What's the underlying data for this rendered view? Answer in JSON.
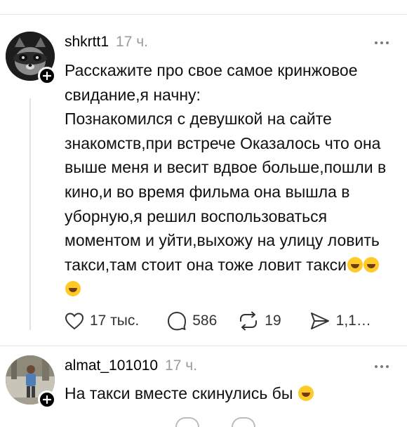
{
  "posts": [
    {
      "username": "shkrtt1",
      "time": "17 ч.",
      "text": "Расскажите про свое самое кринжовое свидание,я начну:\nПознакомился с девушкой на сайте знакомств,при встрече Оказалось что она выше меня и весит вдвое больше,пошли в кино,и во время фильма она вышла в уборную,я решил воспользоваться моментом и уйти,выхожу на улицу ловить такси,там стоит она тоже ловит такси",
      "emoji_count": 3,
      "actions": {
        "likes": "17 тыс.",
        "replies": "586",
        "reposts": "19",
        "shares": "1,1…"
      }
    },
    {
      "username": "almat_101010",
      "time": "17 ч.",
      "text": "На такси вместе скинулись бы",
      "emoji_count": 1
    }
  ],
  "icons": [
    "heart-icon",
    "comment-icon",
    "repost-icon",
    "share-icon",
    "more-icon",
    "plus-icon"
  ]
}
